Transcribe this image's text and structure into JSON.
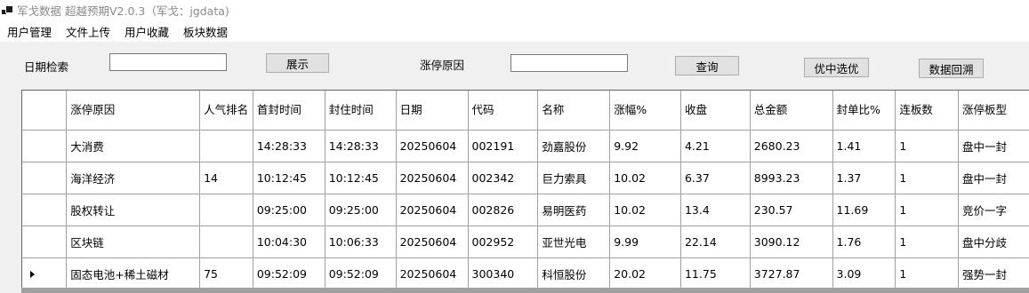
{
  "window": {
    "title": "军戈数据 超越预期V2.0.3（军戈：jgdata)"
  },
  "menu": [
    "用户管理",
    "文件上传",
    "用户收藏",
    "板块数据"
  ],
  "query": {
    "date_label": "日期检索",
    "date_value": "",
    "show_button": "展示",
    "reason_label": "涨停原因",
    "reason_value": "",
    "search_button": "查询",
    "pick_button": "优中选优",
    "backtest_button": "数据回溯"
  },
  "table": {
    "columns": [
      "涨停原因",
      "人气排名",
      "首封时间",
      "封住时间",
      "日期",
      "代码",
      "名称",
      "涨幅%",
      "收盘",
      "总金额",
      "封单比%",
      "连板数",
      "涨停板型"
    ],
    "rows": [
      [
        "大消费",
        "",
        "14:28:33",
        "14:28:33",
        "20250604",
        "002191",
        "劲嘉股份",
        "9.92",
        "4.21",
        "2680.23",
        "1.41",
        "1",
        "盘中一封"
      ],
      [
        "海洋经济",
        "14",
        "10:12:45",
        "10:12:45",
        "20250604",
        "002342",
        "巨力索具",
        "10.02",
        "6.37",
        "8993.23",
        "1.37",
        "1",
        "盘中一封"
      ],
      [
        "股权转让",
        "",
        "09:25:00",
        "09:25:00",
        "20250604",
        "002826",
        "易明医药",
        "10.02",
        "13.4",
        "230.57",
        "11.69",
        "1",
        "竞价一字"
      ],
      [
        "区块链",
        "",
        "10:04:30",
        "10:06:33",
        "20250604",
        "002952",
        "亚世光电",
        "9.99",
        "22.14",
        "3090.12",
        "1.76",
        "1",
        "盘中分歧"
      ],
      [
        "固态电池+稀土磁材",
        "75",
        "09:52:09",
        "09:52:09",
        "20250604",
        "300340",
        "科恒股份",
        "20.02",
        "11.75",
        "3727.87",
        "3.09",
        "1",
        "强势一封"
      ]
    ],
    "current_row": 5
  }
}
